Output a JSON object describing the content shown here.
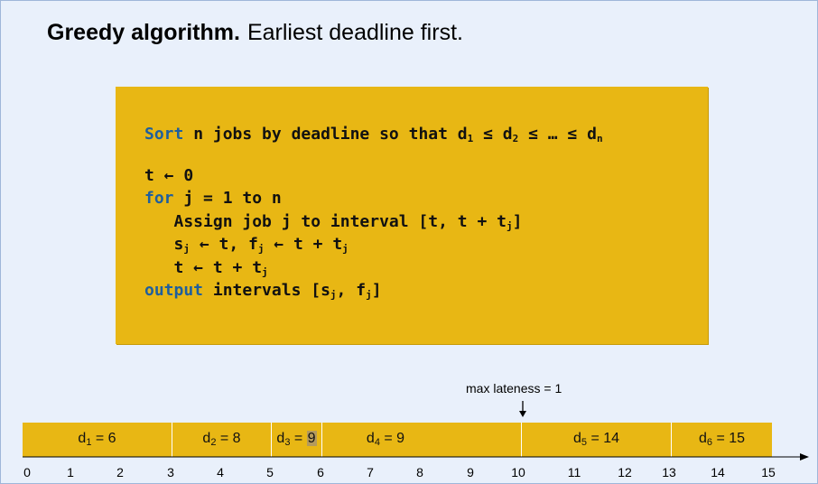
{
  "title": {
    "bold": "Greedy algorithm.",
    "rest": "Earliest deadline first."
  },
  "code": {
    "line1": {
      "kw": "Sort",
      "text": " n jobs by deadline so that d",
      "s1": "1",
      "t2": " ≤ d",
      "s2": "2",
      "t3": " ≤ … ≤ d",
      "s3": "n"
    },
    "line2": "t ← 0",
    "line3": {
      "kw": "for",
      "text": " j = 1 to n"
    },
    "line4": {
      "text": "   Assign job j to interval [t, t + t",
      "s": "j",
      "end": "]"
    },
    "line5": {
      "a": "   s",
      "s1": "j",
      "b": " ← t, f",
      "s2": "j",
      "c": " ← t + t",
      "s3": "j"
    },
    "line6": {
      "a": "   t ← t + t",
      "s": "j"
    },
    "line7": {
      "kw": "output",
      "a": " intervals [s",
      "s1": "j",
      "b": ", f",
      "s2": "j",
      "c": "]"
    }
  },
  "annotation": {
    "max_lateness": "max lateness = 1",
    "arrow": "↓"
  },
  "segments": [
    {
      "pre": "d",
      "sub": "1",
      "post": " = 6"
    },
    {
      "pre": "d",
      "sub": "2",
      "post": " = 8"
    },
    {
      "pre": "d",
      "sub": "3",
      "post": " = ",
      "late": "9"
    },
    {
      "pre": "d",
      "sub": "4",
      "post": " = 9"
    },
    {
      "pre": "d",
      "sub": "5",
      "post": " = 14"
    },
    {
      "pre": "d",
      "sub": "6",
      "post": " = 15"
    }
  ],
  "ticks": [
    "0",
    "1",
    "2",
    "3",
    "4",
    "5",
    "6",
    "7",
    "8",
    "9",
    "10",
    "11",
    "12",
    "13",
    "14",
    "15"
  ],
  "colors": {
    "background": "#e9f0fb",
    "block": "#e8b714",
    "keyword": "#1f5f9d",
    "late_highlight": "#b49a5c"
  }
}
